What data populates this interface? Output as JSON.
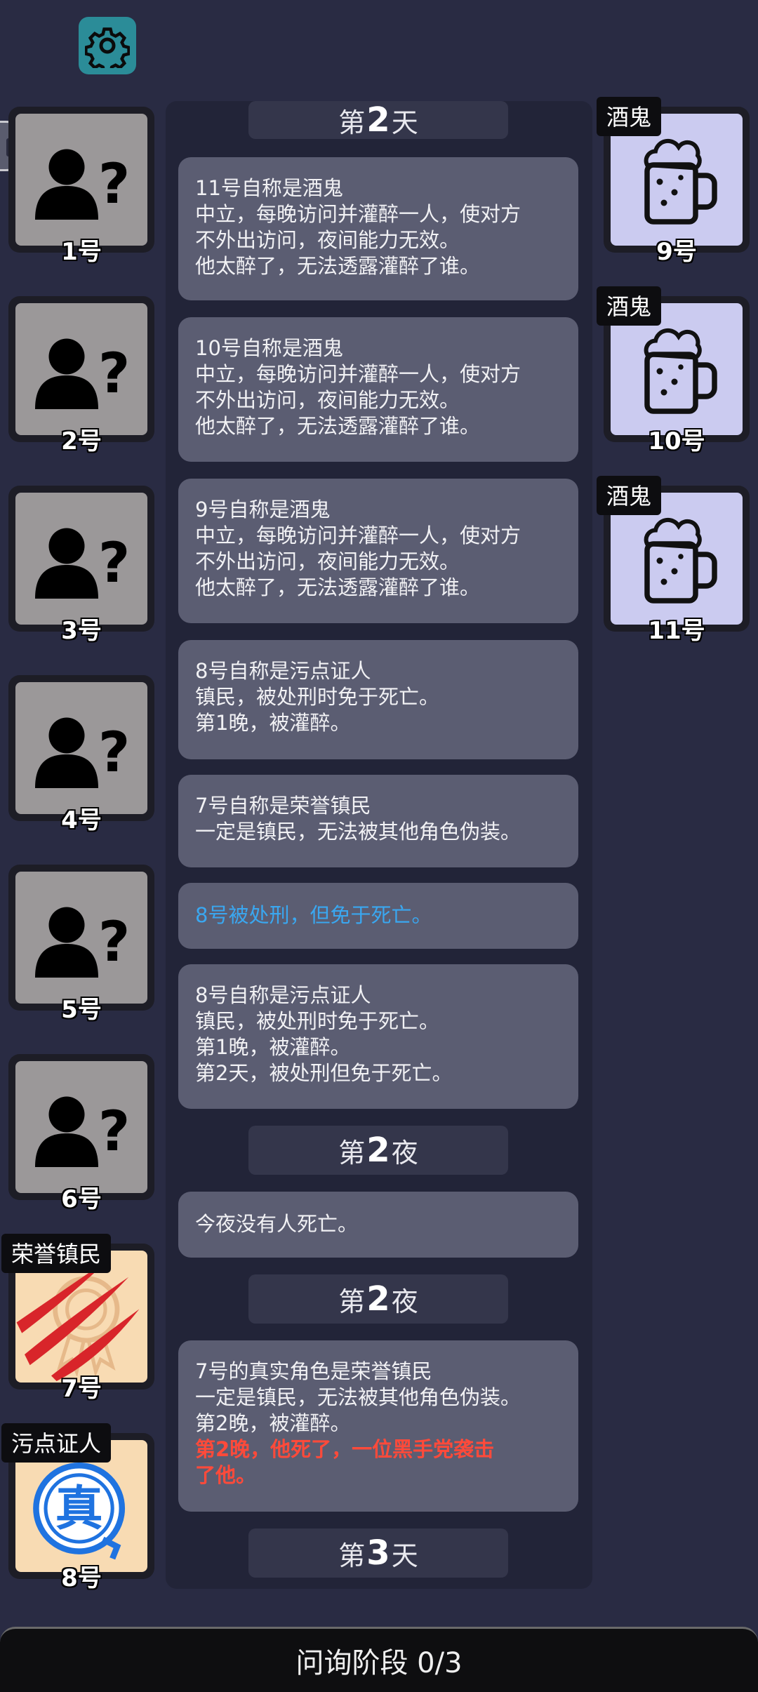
{
  "header": {
    "settings_icon": "gear-icon",
    "handle_icon": "pause-icon"
  },
  "left_players": [
    {
      "number": "1号",
      "role_tag": "",
      "icon": "unknown-person-icon"
    },
    {
      "number": "2号",
      "role_tag": "",
      "icon": "unknown-person-icon"
    },
    {
      "number": "3号",
      "role_tag": "",
      "icon": "unknown-person-icon"
    },
    {
      "number": "4号",
      "role_tag": "",
      "icon": "unknown-person-icon"
    },
    {
      "number": "5号",
      "role_tag": "",
      "icon": "unknown-person-icon"
    },
    {
      "number": "6号",
      "role_tag": "",
      "icon": "unknown-person-icon"
    },
    {
      "number": "7号",
      "role_tag": "荣誉镇民",
      "icon": "medal-icon",
      "status": "dead-claw-marks"
    },
    {
      "number": "8号",
      "role_tag": "污点证人",
      "icon": "verified-stamp-icon",
      "stamp_text": "真"
    }
  ],
  "right_players": [
    {
      "number": "9号",
      "role_tag": "酒鬼",
      "icon": "beer-mug-icon"
    },
    {
      "number": "10号",
      "role_tag": "酒鬼",
      "icon": "beer-mug-icon"
    },
    {
      "number": "11号",
      "role_tag": "酒鬼",
      "icon": "beer-mug-icon"
    }
  ],
  "log": {
    "day2_header": {
      "prefix": "第",
      "num": "2",
      "suffix": "天"
    },
    "m1": {
      "l1": "11号自称是酒鬼",
      "l2": "中立，每晚访问并灌醉一人，使对方",
      "l3": "不外出访问，夜间能力无效。",
      "l4": "他太醉了，无法透露灌醉了谁。"
    },
    "m2": {
      "l1": "10号自称是酒鬼",
      "l2": "中立，每晚访问并灌醉一人，使对方",
      "l3": "不外出访问，夜间能力无效。",
      "l4": "他太醉了，无法透露灌醉了谁。"
    },
    "m3": {
      "l1": "9号自称是酒鬼",
      "l2": "中立，每晚访问并灌醉一人，使对方",
      "l3": "不外出访问，夜间能力无效。",
      "l4": "他太醉了，无法透露灌醉了谁。"
    },
    "m4": {
      "l1": "8号自称是污点证人",
      "l2": "镇民，被处刑时免于死亡。",
      "l3": "第1晚，被灌醉。"
    },
    "m5": {
      "l1": "7号自称是荣誉镇民",
      "l2": "一定是镇民，无法被其他角色伪装。"
    },
    "m6": {
      "l1": "8号被处刑，但免于死亡。"
    },
    "m7": {
      "l1": "8号自称是污点证人",
      "l2": "镇民，被处刑时免于死亡。",
      "l3": "第1晚，被灌醉。",
      "l4": "第2天，被处刑但免于死亡。"
    },
    "night2_header_a": {
      "prefix": "第",
      "num": "2",
      "suffix": "夜"
    },
    "m8": {
      "l1": "今夜没有人死亡。"
    },
    "night2_header_b": {
      "prefix": "第",
      "num": "2",
      "suffix": "夜"
    },
    "m9": {
      "l1": "7号的真实角色是荣誉镇民",
      "l2": "一定是镇民，无法被其他角色伪装。",
      "l3": "第2晚，被灌醉。",
      "l4": "第2晚，他死了，一位黑手党袭击",
      "l5": "了他。"
    },
    "day3_header": {
      "prefix": "第",
      "num": "3",
      "suffix": "天"
    }
  },
  "footer": {
    "phase_text": "问询阶段 0/3"
  },
  "colors": {
    "background": "#292b43",
    "panel": "#222438",
    "message": "#5b5d72",
    "settings": "#2b8c98",
    "highlight_blue": "#3aa7f0",
    "highlight_red": "#ff4a3a"
  }
}
